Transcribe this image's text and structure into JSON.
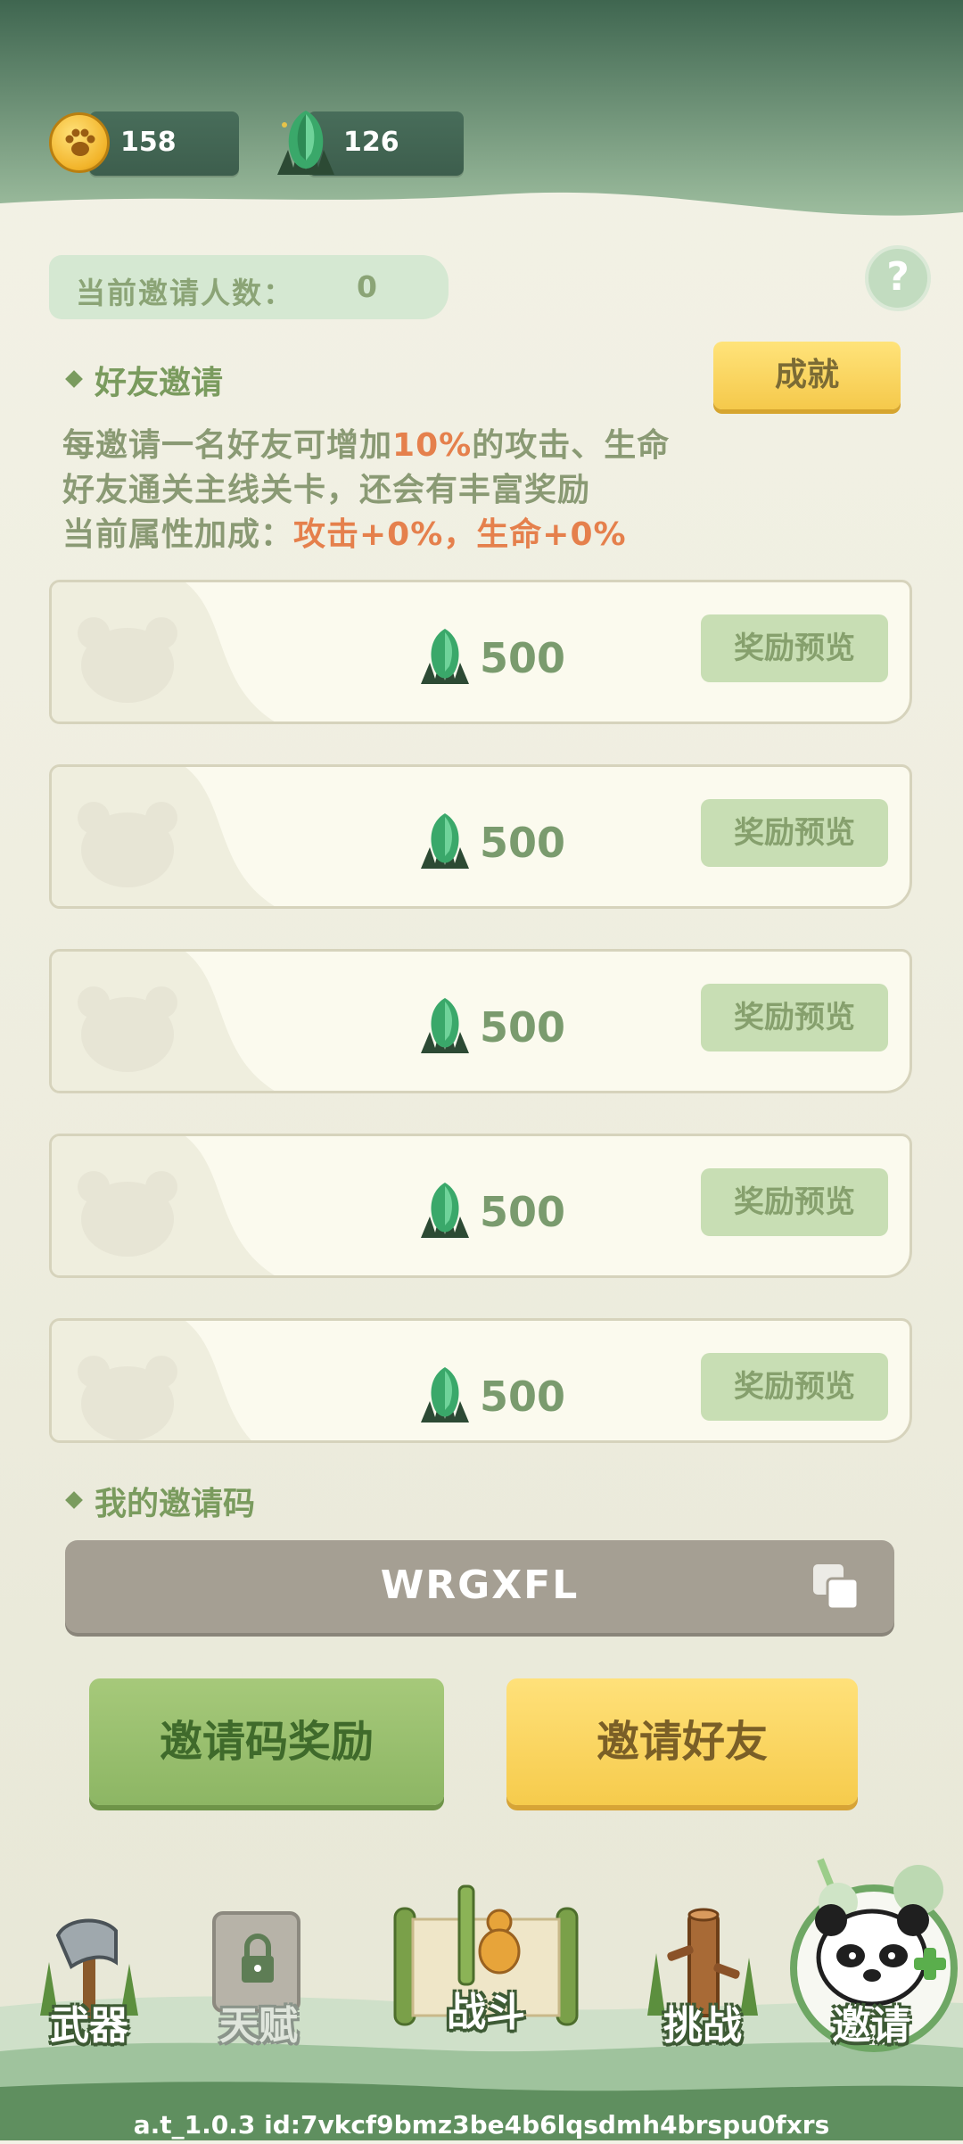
{
  "resources": {
    "paws": "158",
    "gems": "126"
  },
  "invite_count": {
    "label": "当前邀请人数：",
    "value": "0"
  },
  "help": "?",
  "friend_invite": {
    "title": "好友邀请",
    "achievement_btn": "成就",
    "desc_line1_a": "每邀请一名好友可增加",
    "desc_line1_hl": "10%",
    "desc_line1_b": "的攻击、生命",
    "desc_line2": "好友通关主线关卡，还会有丰富奖励",
    "desc_line3_a": "当前属性加成：",
    "desc_line3_hl": "攻击+0%，生命+0%"
  },
  "slots": [
    {
      "amount": "500",
      "preview": "奖励预览"
    },
    {
      "amount": "500",
      "preview": "奖励预览"
    },
    {
      "amount": "500",
      "preview": "奖励预览"
    },
    {
      "amount": "500",
      "preview": "奖励预览"
    },
    {
      "amount": "500",
      "preview": "奖励预览"
    }
  ],
  "my_code": {
    "title": "我的邀请码",
    "code": "WRGXFL"
  },
  "buttons": {
    "code_reward": "邀请码奖励",
    "invite_friends": "邀请好友"
  },
  "nav": {
    "weapon": "武器",
    "talent": "天赋",
    "battle": "战斗",
    "challenge": "挑战",
    "invite": "邀请"
  },
  "version": "a.t_1.0.3 id:7vkcf9bmz3be4b6lqsdmh4brspu0fxrs"
}
